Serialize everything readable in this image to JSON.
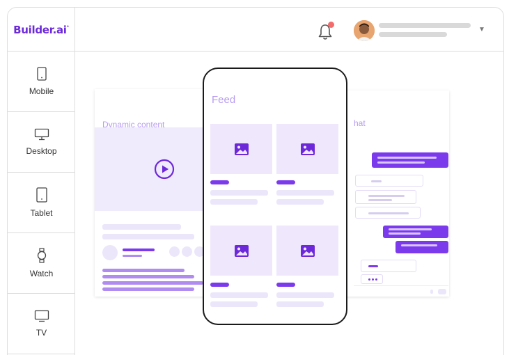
{
  "brand": {
    "name": "Builder.ai",
    "mark": "°"
  },
  "header": {
    "notification_icon": "bell-icon",
    "has_notification": true,
    "user_menu_icon": "chevron-down-icon"
  },
  "sidebar": {
    "items": [
      {
        "label": "Mobile",
        "icon": "mobile-icon"
      },
      {
        "label": "Desktop",
        "icon": "desktop-icon"
      },
      {
        "label": "Tablet",
        "icon": "tablet-icon"
      },
      {
        "label": "Watch",
        "icon": "watch-icon"
      },
      {
        "label": "TV",
        "icon": "tv-icon"
      }
    ]
  },
  "canvas": {
    "left_card": {
      "title": "Dynamic content",
      "media_icon": "play-icon"
    },
    "right_card": {
      "title_visible": "hat"
    },
    "phone": {
      "title": "Feed",
      "tile_icon": "image-icon"
    }
  },
  "colors": {
    "brand": "#6c2bd9",
    "accent": "#7c3aed",
    "light": "#efe8fd",
    "notification": "#f36b6b"
  }
}
